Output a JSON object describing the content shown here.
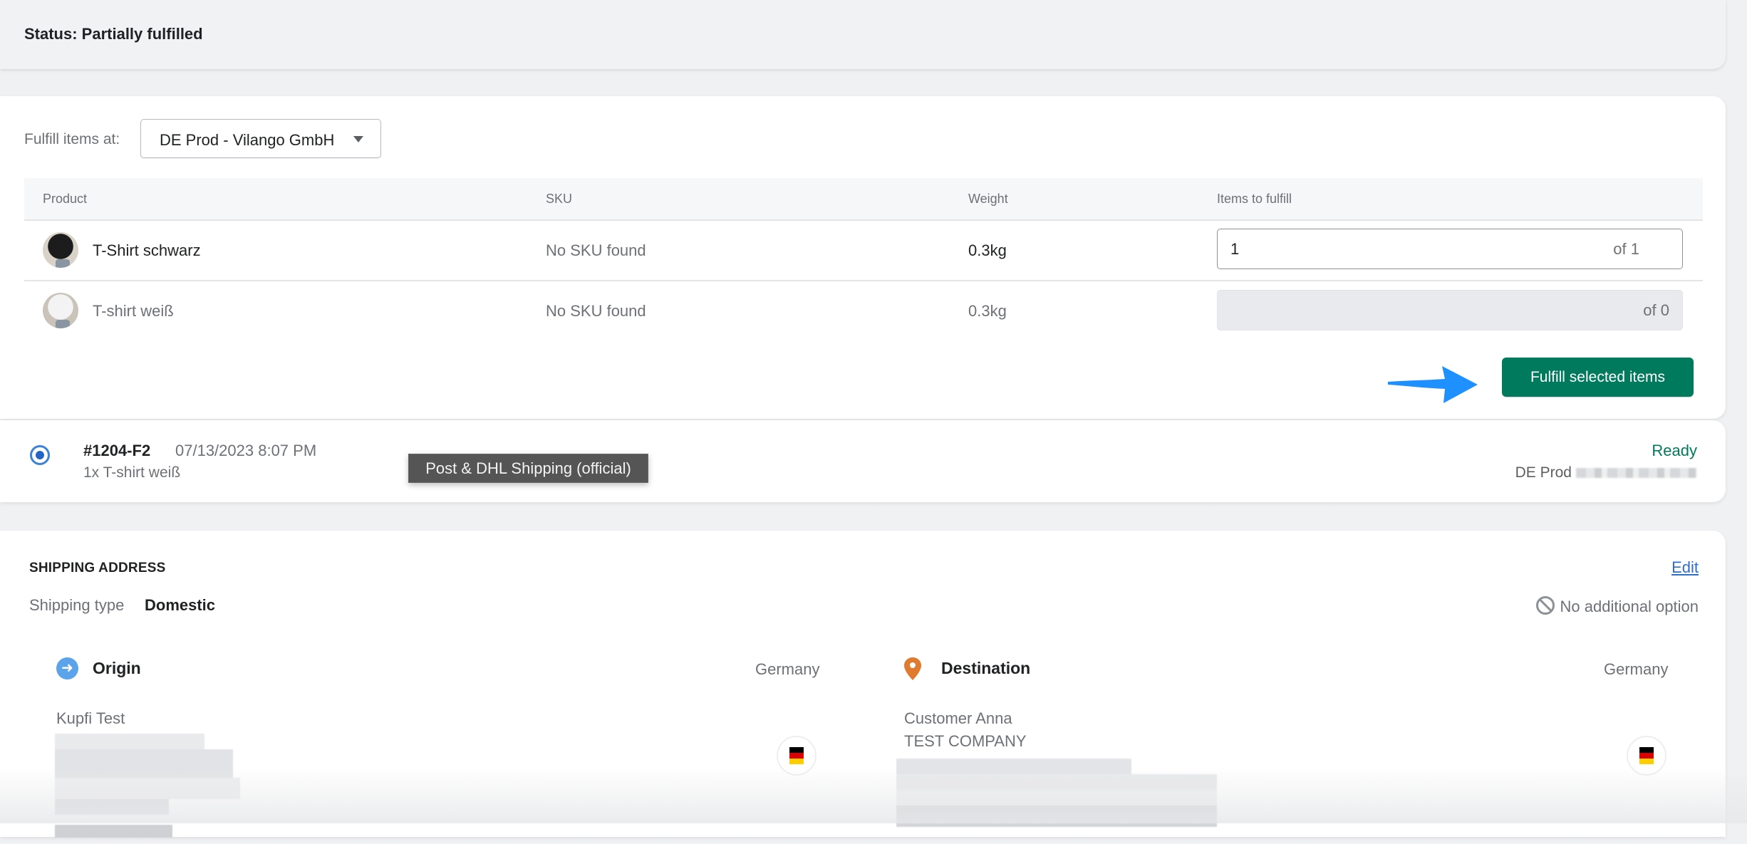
{
  "status": {
    "text": "Status: Partially fulfilled"
  },
  "fulfill": {
    "location_label": "Fulfill items at:",
    "location_selected": "DE Prod - Vilango GmbH",
    "table": {
      "headers": [
        "Product",
        "SKU",
        "Weight",
        "Items to fulfill"
      ],
      "rows": [
        {
          "product": "T-Shirt schwarz",
          "sku": "No SKU found",
          "weight": "0.3kg",
          "qty_value": "1",
          "qty_of": "of 1",
          "enabled": true
        },
        {
          "product": "T-shirt weiß",
          "sku": "No SKU found",
          "weight": "0.3kg",
          "qty_value": "",
          "qty_of": "of 0",
          "enabled": false
        }
      ]
    },
    "button_label": "Fulfill selected items",
    "colors": {
      "primary": "#007a5c",
      "annotation_arrow": "#1e90ff"
    }
  },
  "fulfillment": {
    "id": "#1204-F2",
    "date": "07/13/2023 8:07 PM",
    "items": "1x T-shirt weiß",
    "tooltip": "Post & DHL Shipping (official)",
    "status": "Ready",
    "location": "DE Prod",
    "status_color": "#007a5c"
  },
  "shipping": {
    "title": "SHIPPING ADDRESS",
    "edit_label": "Edit",
    "type_label": "Shipping type",
    "type_value": "Domestic",
    "option": "No additional option",
    "origin": {
      "label": "Origin",
      "country": "Germany",
      "name": "Kupfi Test",
      "icon": "arrow-right-circle-icon"
    },
    "destination": {
      "label": "Destination",
      "country": "Germany",
      "name": "Customer Anna",
      "company": "TEST COMPANY",
      "icon": "map-pin-icon"
    }
  }
}
